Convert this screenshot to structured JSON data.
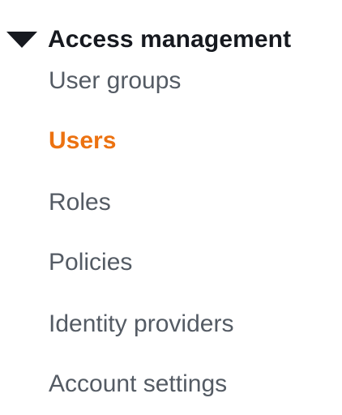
{
  "section": {
    "title": "Access management",
    "expanded": true,
    "icon": "caret-down-icon"
  },
  "nav": {
    "items": [
      {
        "label": "User groups",
        "active": false
      },
      {
        "label": "Users",
        "active": true
      },
      {
        "label": "Roles",
        "active": false
      },
      {
        "label": "Policies",
        "active": false
      },
      {
        "label": "Identity providers",
        "active": false
      },
      {
        "label": "Account settings",
        "active": false
      }
    ]
  },
  "colors": {
    "header_text": "#16191f",
    "item_text": "#545b64",
    "active_text": "#ec7211",
    "background": "#ffffff"
  }
}
